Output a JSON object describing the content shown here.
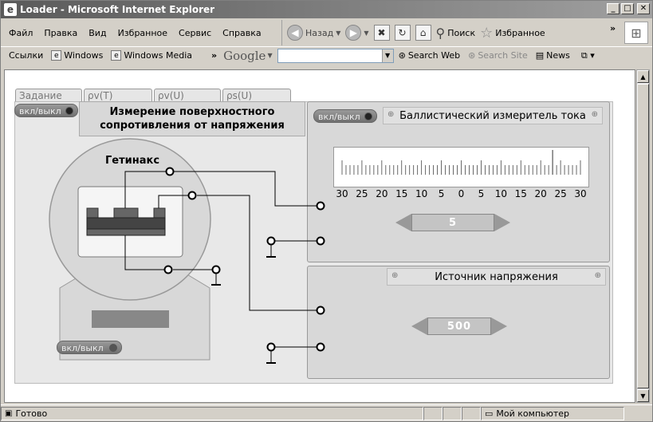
{
  "window": {
    "title": "Loader - Microsoft Internet Explorer",
    "btn_min": "_",
    "btn_max": "□",
    "btn_close": "✕"
  },
  "menu": [
    "Файл",
    "Правка",
    "Вид",
    "Избранное",
    "Сервис",
    "Справка"
  ],
  "nav": {
    "back": "Назад",
    "search": "Поиск",
    "favorites": "Избранное"
  },
  "links": {
    "label": "Ссылки",
    "items": [
      "Windows",
      "Windows Media"
    ],
    "google": "Google",
    "search_web": "Search Web",
    "search_site": "Search Site",
    "news": "News"
  },
  "app": {
    "tabs": [
      "Задание",
      "ρv(T)",
      "ρv(U)",
      "ρs(U)"
    ],
    "power_label": "вкл/выкл",
    "title_line1": "Измерение поверхностного",
    "title_line2": "сопротивления от напряжения",
    "sample_label": "Гетинакс",
    "meter_title": "Баллистический измеритель тока",
    "meter_scale": [
      "30",
      "25",
      "20",
      "15",
      "10",
      "5",
      "0",
      "5",
      "10",
      "15",
      "20",
      "25",
      "30"
    ],
    "meter_value": "5",
    "source_title": "Источник напряжения",
    "source_value": "500"
  },
  "status": {
    "text": "Готово",
    "zone": "Мой компьютер"
  }
}
